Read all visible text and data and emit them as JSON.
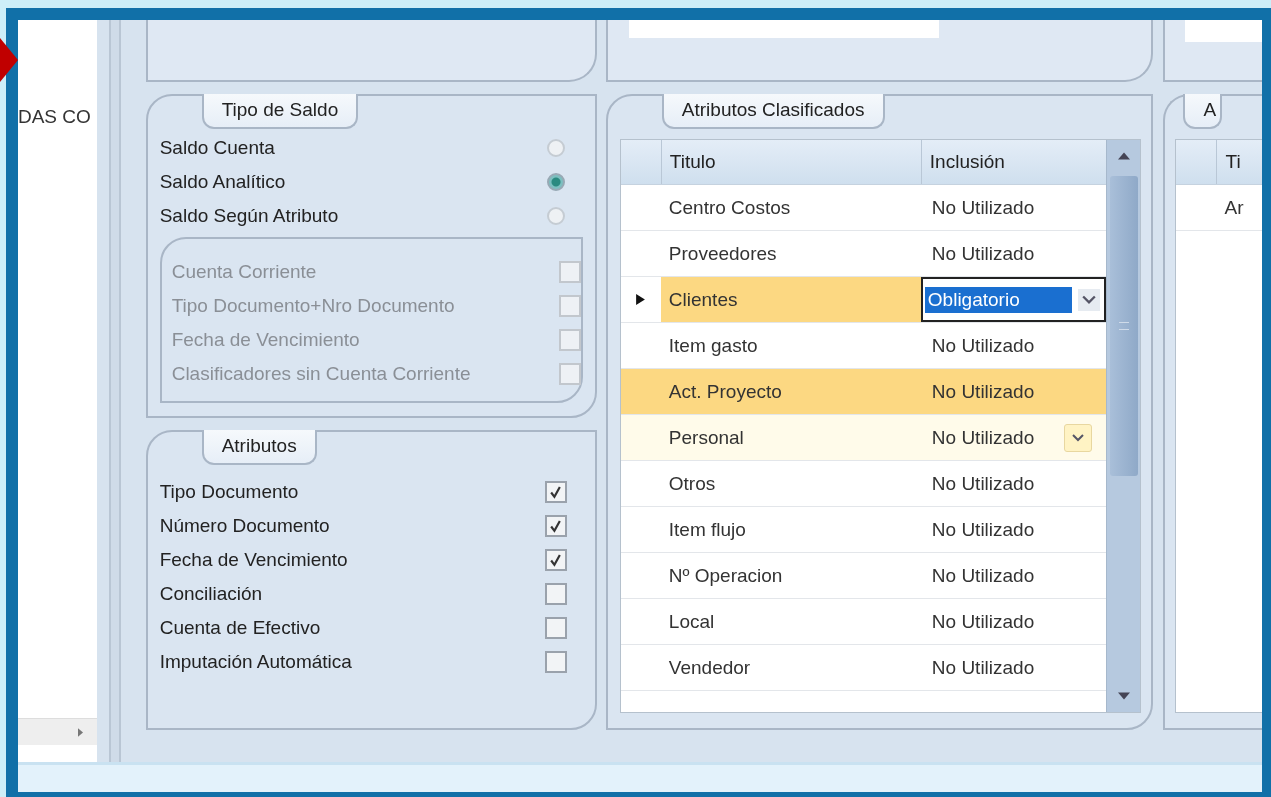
{
  "nav_pane": {
    "text": "DAS CO"
  },
  "saldo_group": {
    "title": "Tipo de Saldo",
    "options": [
      {
        "label": "Saldo Cuenta",
        "selected": false
      },
      {
        "label": "Saldo Analítico",
        "selected": true
      },
      {
        "label": "Saldo Según Atributo",
        "selected": false
      }
    ],
    "sub_options": [
      {
        "label": "Cuenta Corriente",
        "checked": false,
        "disabled": true
      },
      {
        "label": "Tipo Documento+Nro Documento",
        "checked": false,
        "disabled": true
      },
      {
        "label": "Fecha de Vencimiento",
        "checked": false,
        "disabled": true
      },
      {
        "label": "Clasificadores sin Cuenta Corriente",
        "checked": false,
        "disabled": true
      }
    ]
  },
  "atributos_group": {
    "title": "Atributos",
    "items": [
      {
        "label": "Tipo Documento",
        "checked": true
      },
      {
        "label": "Número Documento",
        "checked": true
      },
      {
        "label": "Fecha de Vencimiento",
        "checked": true
      },
      {
        "label": "Conciliación",
        "checked": false
      },
      {
        "label": "Cuenta de Efectivo",
        "checked": false
      },
      {
        "label": "Imputación Automática",
        "checked": false
      }
    ]
  },
  "classified_group": {
    "title": "Atributos Clasificados",
    "columns": [
      "Titulo",
      "Inclusión"
    ],
    "rows": [
      {
        "titulo": "Centro Costos",
        "inclusion": "No Utilizado",
        "selected": false,
        "highlighted": false,
        "hot": false
      },
      {
        "titulo": "Proveedores",
        "inclusion": "No Utilizado",
        "selected": false,
        "highlighted": false,
        "hot": false
      },
      {
        "titulo": "Clientes",
        "inclusion": "Obligatorio",
        "selected": true,
        "highlighted": false,
        "hot": false
      },
      {
        "titulo": "Item gasto",
        "inclusion": "No Utilizado",
        "selected": false,
        "highlighted": false,
        "hot": false
      },
      {
        "titulo": "Act. Proyecto",
        "inclusion": "No Utilizado",
        "selected": false,
        "highlighted": true,
        "hot": false
      },
      {
        "titulo": "Personal",
        "inclusion": "No Utilizado",
        "selected": false,
        "highlighted": false,
        "hot": true
      },
      {
        "titulo": "Otros",
        "inclusion": "No Utilizado",
        "selected": false,
        "highlighted": false,
        "hot": false
      },
      {
        "titulo": "Item flujo",
        "inclusion": "No Utilizado",
        "selected": false,
        "highlighted": false,
        "hot": false
      },
      {
        "titulo": "Nº Operacion",
        "inclusion": "No Utilizado",
        "selected": false,
        "highlighted": false,
        "hot": false
      },
      {
        "titulo": "Local",
        "inclusion": "No Utilizado",
        "selected": false,
        "highlighted": false,
        "hot": false
      },
      {
        "titulo": "Vendedor",
        "inclusion": "No Utilizado",
        "selected": false,
        "highlighted": false,
        "hot": false
      }
    ]
  },
  "right_group": {
    "title": "A",
    "column": "Ti",
    "rows": [
      "Ar"
    ]
  }
}
